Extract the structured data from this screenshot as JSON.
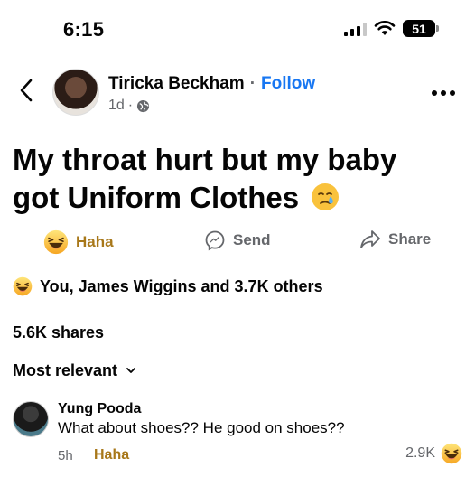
{
  "status_bar": {
    "time": "6:15",
    "battery": "51",
    "icons": [
      "signal-icon",
      "wifi-icon",
      "battery-icon"
    ]
  },
  "post": {
    "author": "Tiricka Beckham",
    "separator": "·",
    "follow_label": "Follow",
    "age": "1d",
    "meta_separator": "·",
    "audience_icon": "globe-icon",
    "text": "My throat hurt but my baby got Uniform Clothes",
    "text_emoji": "crying-face"
  },
  "actions": {
    "haha_label": "Haha",
    "send_label": "Send",
    "share_label": "Share"
  },
  "reactions": {
    "summary": "You, James Wiggins and 3.7K others",
    "icon": "haha-emoji"
  },
  "shares": "5.6K shares",
  "sort": {
    "label": "Most relevant",
    "icon": "chevron-down-icon"
  },
  "comment": {
    "author": "Yung Pooda",
    "text": "What about shoes?? He good on shoes??",
    "time": "5h",
    "reaction_label": "Haha",
    "reaction_count": "2.9K"
  },
  "colors": {
    "accent_blue": "#1877f2",
    "haha_gold": "#a8781a",
    "secondary_text": "#65676b"
  }
}
